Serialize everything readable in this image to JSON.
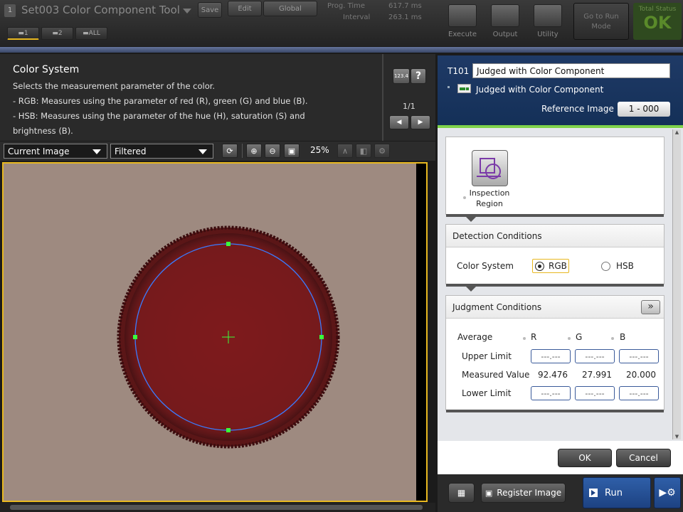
{
  "topbar": {
    "title": "Set003 Color Component Tool",
    "save_label": "Save",
    "edit_label": "Edit",
    "global_label": "Global",
    "prog_time_label": "Prog. Time",
    "prog_time_value": "617.7 ms",
    "interval_label": "Interval",
    "interval_value": "263.1 ms",
    "tabs": [
      "1",
      "2",
      "ALL"
    ],
    "execute_label": "Execute",
    "output_label": "Output",
    "utility_label": "Utility",
    "goto_run_label": "Go to Run Mode",
    "status_label": "Total Status",
    "status_value": "OK"
  },
  "help": {
    "title": "Color System",
    "lines": [
      "Selects the measurement parameter of the color.",
      "- RGB: Measures using the parameter of red (R), green (G) and blue (B).",
      "- HSB: Measures using the parameter of the hue (H), saturation (S) and",
      "brightness (B)."
    ],
    "num_label": "123.4",
    "help_label": "?",
    "page_indicator": "1/1"
  },
  "toolbar": {
    "image_select": "Current Image",
    "filter_select": "Filtered",
    "zoom_level": "25%"
  },
  "tool_header": {
    "id": "T101",
    "name_value": "Judged with Color Component",
    "type_label": "Judged with Color Component",
    "reference_label": "Reference Image",
    "reference_value": "1 - 000"
  },
  "inspection": {
    "label_line1": "Inspection",
    "label_line2": "Region"
  },
  "detection": {
    "title": "Detection Conditions",
    "color_system_label": "Color System",
    "option_rgb": "RGB",
    "option_hsb": "HSB",
    "selected": "RGB"
  },
  "judgment": {
    "title": "Judgment Conditions",
    "expand_label": "»",
    "average_label": "Average",
    "channels": [
      "R",
      "G",
      "B"
    ],
    "upper_label": "Upper Limit",
    "measured_label": "Measured Value",
    "lower_label": "Lower Limit",
    "upper_values": [
      "---.---",
      "---.---",
      "---.---"
    ],
    "measured_values": [
      "92.476",
      "27.991",
      "20.000"
    ],
    "lower_values": [
      "---.---",
      "---.---",
      "---.---"
    ]
  },
  "actions": {
    "ok_label": "OK",
    "cancel_label": "Cancel",
    "register_label": "Register Image",
    "run_label": "Run"
  },
  "colors": {
    "accent_blue": "#1f3a66",
    "ok_green": "#6fc23a",
    "selection_yellow": "#e8b820",
    "region_circle": "#3a7cff",
    "handle_green": "#3aff3a"
  }
}
